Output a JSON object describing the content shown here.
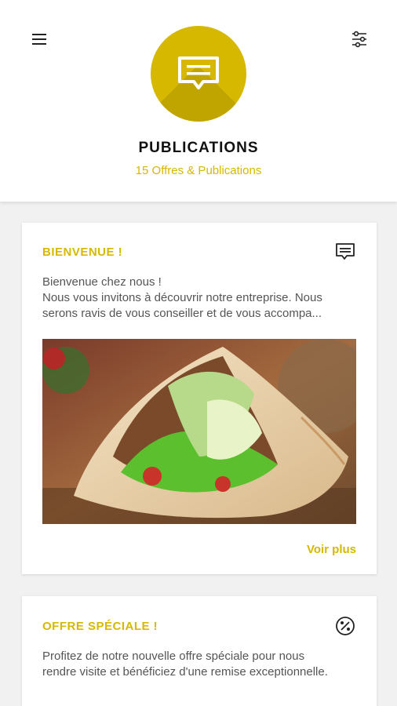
{
  "header": {
    "title": "PUBLICATIONS",
    "subtitle": "15 Offres & Publications",
    "menu_icon": "hamburger-menu-icon",
    "filter_icon": "filter-sliders-icon",
    "hero_icon": "message-icon"
  },
  "colors": {
    "accent": "#d6b800",
    "background": "#f1f1f1",
    "card": "#ffffff",
    "text": "#555555",
    "title": "#111111"
  },
  "publications": [
    {
      "title": "BIENVENUE !",
      "icon": "message-icon",
      "text_lines": [
        "Bienvenue chez nous !",
        "Nous vous invitons à découvrir notre entreprise. Nous",
        "serons ravis de vous conseiller et de vous accompa..."
      ],
      "image": "kebab-sandwich-photo",
      "more_label": "Voir plus"
    },
    {
      "title": "OFFRE SPÉCIALE !",
      "icon": "percent-badge-icon",
      "text_lines": [
        "Profitez de notre nouvelle offre spéciale pour nous",
        "rendre visite et bénéficiez d'une remise exceptionnelle."
      ]
    }
  ]
}
